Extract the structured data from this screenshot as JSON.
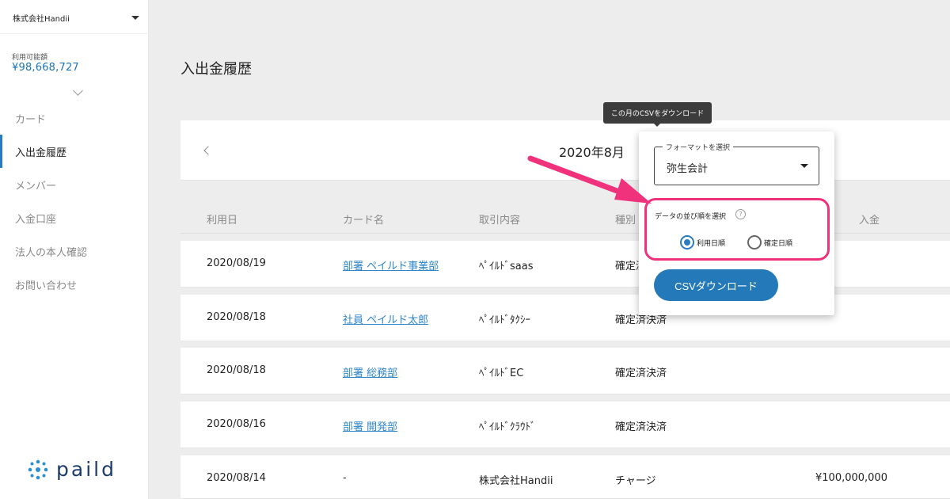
{
  "sidebar": {
    "company": "株式会社Handii",
    "balance_label": "利用可能額",
    "balance_value": "¥98,668,727",
    "nav": [
      {
        "label": "カード"
      },
      {
        "label": "入出金履歴"
      },
      {
        "label": "メンバー"
      },
      {
        "label": "入金口座"
      },
      {
        "label": "法人の本人確認"
      },
      {
        "label": "お問い合わせ"
      }
    ],
    "logo_text": "paild"
  },
  "page": {
    "title": "入出金履歴",
    "month": "2020年8月"
  },
  "table": {
    "headers": [
      "利用日",
      "カード名",
      "取引内容",
      "種別",
      "入金"
    ],
    "rows": [
      {
        "date": "2020/08/19",
        "card": "部署 ペイルド事業部",
        "desc": "ﾍﾟｲﾙﾄﾞsaas",
        "type": "確定済",
        "deposit": ""
      },
      {
        "date": "2020/08/18",
        "card": "社員 ペイルド太郎",
        "desc": "ﾍﾟｲﾙﾄﾞﾀｸｼｰ",
        "type": "確定済決済",
        "deposit": ""
      },
      {
        "date": "2020/08/18",
        "card": "部署 総務部",
        "desc": "ﾍﾟｲﾙﾄﾞEC",
        "type": "確定済決済",
        "deposit": ""
      },
      {
        "date": "2020/08/16",
        "card": "部署 開発部",
        "desc": "ﾍﾟｲﾙﾄﾞｸﾗｳﾄﾞ",
        "type": "確定済決済",
        "deposit": ""
      },
      {
        "date": "2020/08/14",
        "card": "-",
        "desc": "株式会社Handii",
        "type": "チャージ",
        "deposit": "¥100,000,000"
      }
    ]
  },
  "popover": {
    "tooltip": "この月のCSVをダウンロード",
    "format_legend": "フォーマットを選択",
    "format_value": "弥生会計",
    "order_label": "データの並び順を選択",
    "help_glyph": "?",
    "radio_usage": "利用日順",
    "radio_confirm": "確定日順",
    "selected_order": "利用日順",
    "download_button": "CSVダウンロード"
  },
  "colors": {
    "accent": "#2479b8",
    "highlight": "#f0327d",
    "link": "#2f86c8"
  },
  "icons": [
    "chevron-down-icon",
    "chevron-left-icon",
    "help-icon",
    "paild-logo-icon",
    "arrow-annotation"
  ]
}
